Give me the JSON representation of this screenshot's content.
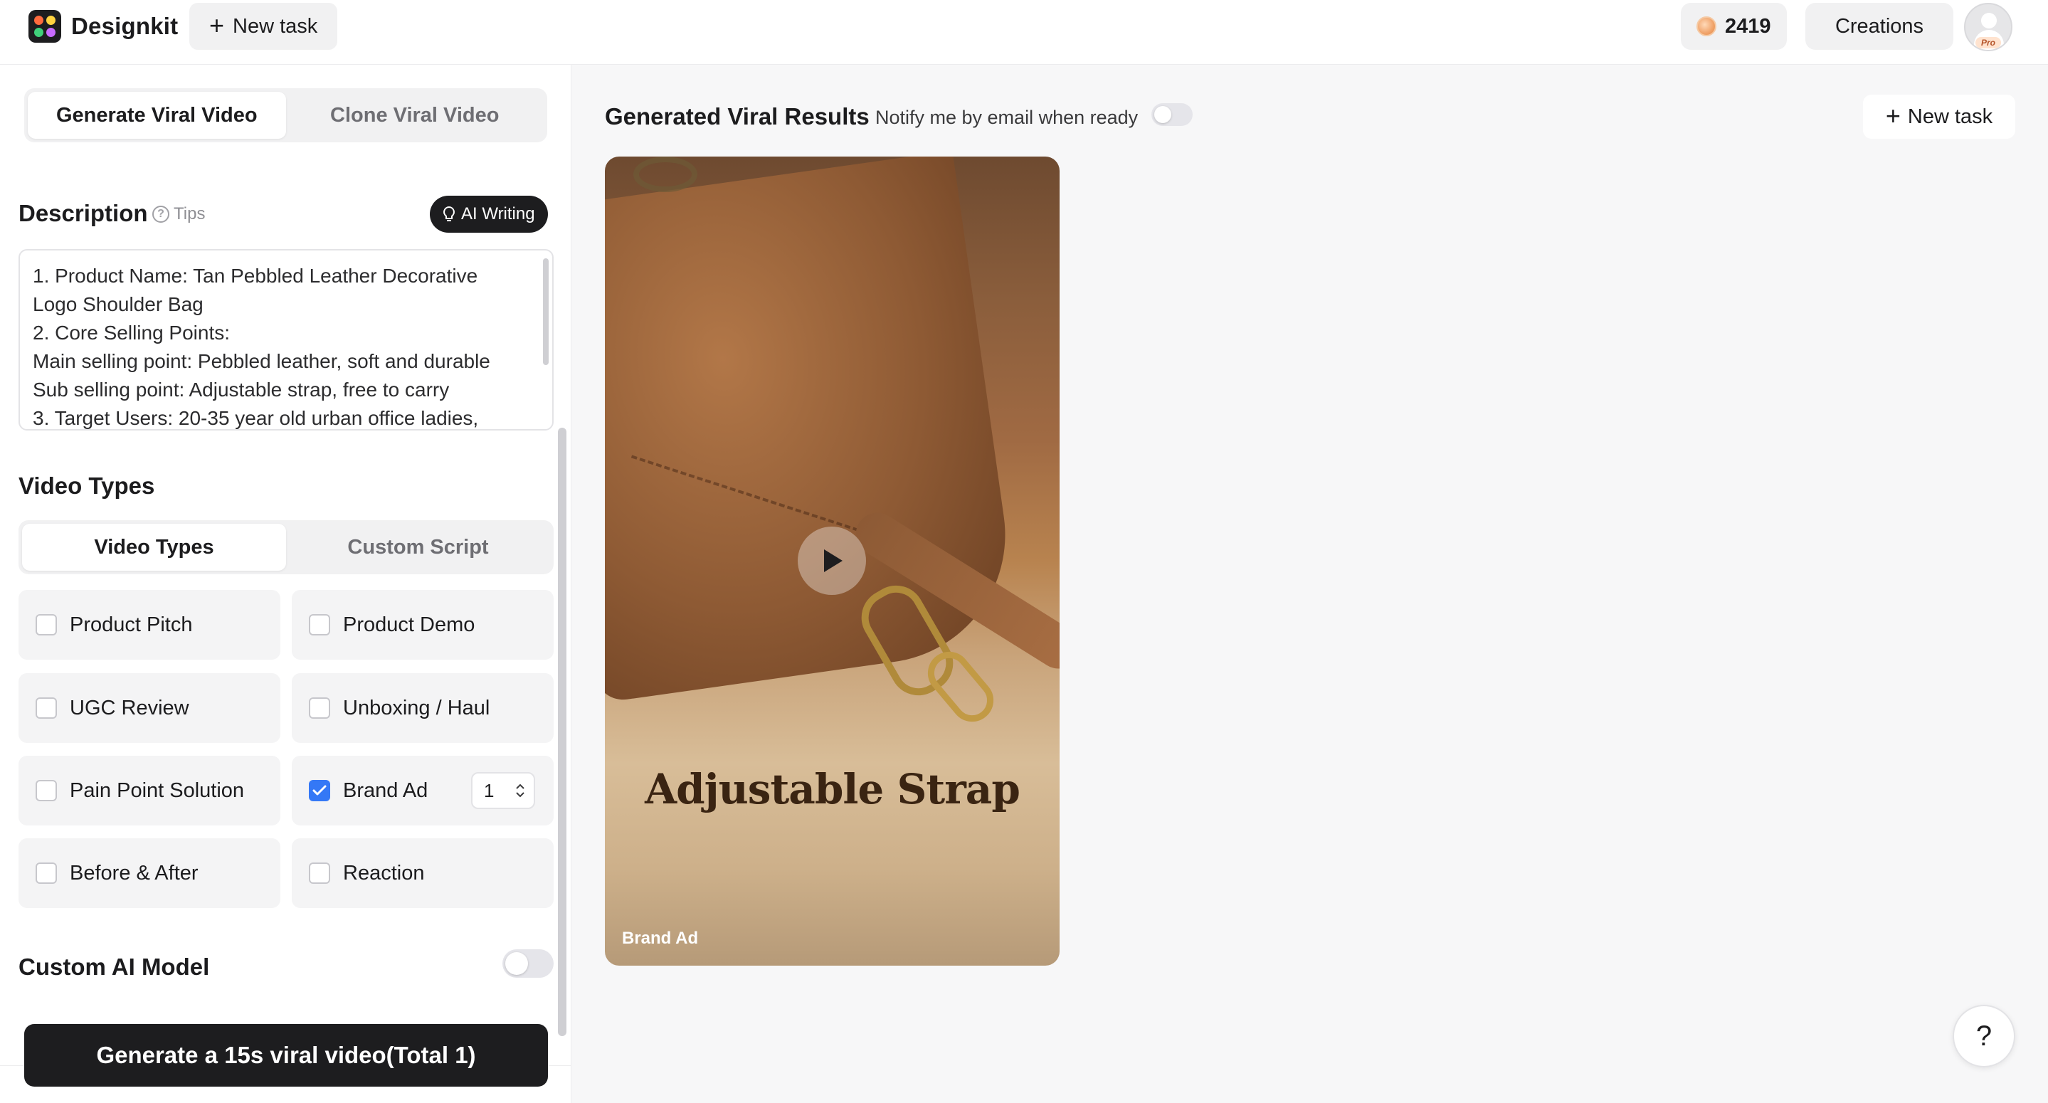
{
  "app": {
    "name": "Designkit",
    "new_task_label": "New task",
    "credits": "2419",
    "creations_label": "Creations",
    "pro_badge": "Pro"
  },
  "mode_tabs": [
    "Generate Viral Video",
    "Clone Viral Video"
  ],
  "description": {
    "title": "Description",
    "tips_label": "Tips",
    "ai_writing_label": "AI Writing",
    "lines": [
      "1. Product Name: Tan Pebbled Leather Decorative",
      "Logo Shoulder Bag",
      "2. Core Selling Points:",
      "Main selling point: Pebbled leather, soft and durable",
      "Sub selling point: Adjustable strap, free to carry",
      "3. Target Users: 20-35 year old urban office ladies,"
    ]
  },
  "video_types": {
    "title": "Video Types",
    "tabs": [
      "Video Types",
      "Custom Script"
    ],
    "options": [
      {
        "label": "Product Pitch",
        "checked": false
      },
      {
        "label": "Product Demo",
        "checked": false
      },
      {
        "label": "UGC Review",
        "checked": false
      },
      {
        "label": "Unboxing / Haul",
        "checked": false
      },
      {
        "label": "Pain Point Solution",
        "checked": false
      },
      {
        "label": "Brand Ad",
        "checked": true,
        "count": "1"
      },
      {
        "label": "Before & After",
        "checked": false
      },
      {
        "label": "Reaction",
        "checked": false
      }
    ]
  },
  "custom_ai_model": {
    "label": "Custom AI Model",
    "enabled": false
  },
  "generate_button": "Generate a 15s viral video(Total 1)",
  "results": {
    "title": "Generated Viral Results",
    "notify_label": "Notify me by email when ready",
    "notify_enabled": false,
    "new_task_label": "New task",
    "videos": [
      {
        "caption": "Adjustable Strap",
        "type_label": "Brand Ad"
      }
    ]
  },
  "help_label": "?",
  "colors": {
    "accent": "#3478f6",
    "dark_button": "#1d1d1f",
    "card_bg": "#f4f4f5"
  }
}
